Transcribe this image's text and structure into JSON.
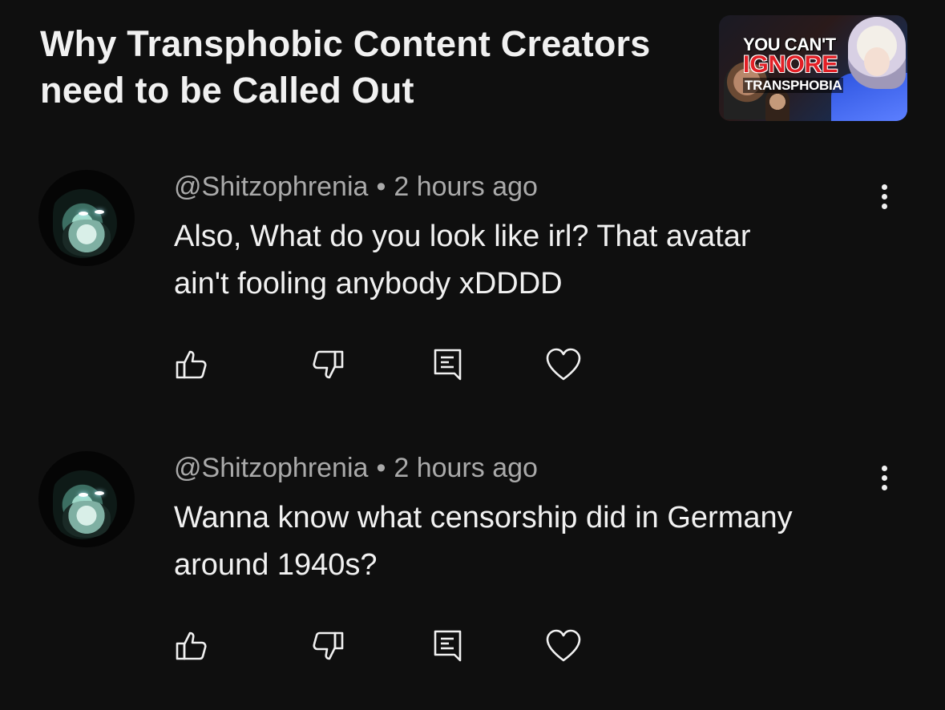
{
  "video": {
    "title_line1": "Why Transphobic Content Creators",
    "title_line2": "need to be Called Out",
    "thumbnail": {
      "text_line1": "YOU CAN'T",
      "text_line2": "IGNORE",
      "text_line3": "TRANSPHOBIA"
    }
  },
  "comments": [
    {
      "author": "@Shitzophrenia",
      "separator": "•",
      "time": "2 hours ago",
      "text_line1": "Also, What do you look like irl? That avatar",
      "text_line2": "ain't fooling anybody xDDDD"
    },
    {
      "author": "@Shitzophrenia",
      "separator": "•",
      "time": "2 hours ago",
      "text_line1": "Wanna know what censorship did in Germany",
      "text_line2": "around 1940s?"
    }
  ],
  "icons": {
    "like": "thumbs-up-icon",
    "dislike": "thumbs-down-icon",
    "reply": "comment-reply-icon",
    "heart": "heart-icon",
    "more": "more-vertical-icon"
  },
  "colors": {
    "background": "#0f0f0f",
    "text_primary": "#f1f1f1",
    "text_secondary": "#aaaaaa",
    "thumb_red": "#e21f26"
  }
}
